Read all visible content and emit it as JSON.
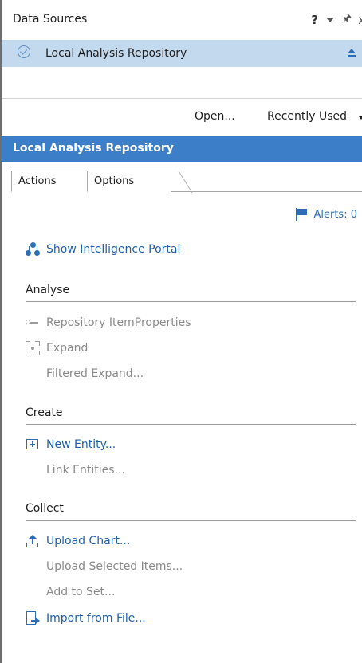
{
  "window": {
    "title": "Data Sources",
    "help_label": "?",
    "pin_label": "⭻",
    "close_label": "x"
  },
  "source": {
    "selected": "Local Analysis Repository"
  },
  "openbar": {
    "open_label": "Open...",
    "recent_label": "Recently Used"
  },
  "repository": {
    "header": "Local Analysis Repository",
    "tabs": [
      {
        "label": "Actions",
        "active": true
      },
      {
        "label": "Options",
        "active": false
      }
    ],
    "alerts_label": "Alerts: 0"
  },
  "actions": {
    "show_portal": "Show Intelligence Portal",
    "analyse": {
      "heading": "Analyse",
      "items": [
        {
          "label": "Repository ItemProperties",
          "enabled": false
        },
        {
          "label": "Expand",
          "enabled": false
        },
        {
          "label": "Filtered Expand...",
          "enabled": false
        }
      ]
    },
    "create": {
      "heading": "Create",
      "items": [
        {
          "label": "New Entity...",
          "enabled": true
        },
        {
          "label": "Link Entities...",
          "enabled": false
        }
      ]
    },
    "collect": {
      "heading": "Collect",
      "items": [
        {
          "label": "Upload Chart...",
          "enabled": true
        },
        {
          "label": "Upload Selected Items...",
          "enabled": false
        },
        {
          "label": "Add to Set...",
          "enabled": false
        },
        {
          "label": "Import from File...",
          "enabled": true
        }
      ]
    }
  },
  "colors": {
    "header_blue": "#3d7ec9",
    "selection_blue": "#c3d9ee",
    "link_blue": "#1f5fab",
    "disabled_gray": "#8a8a8a"
  }
}
